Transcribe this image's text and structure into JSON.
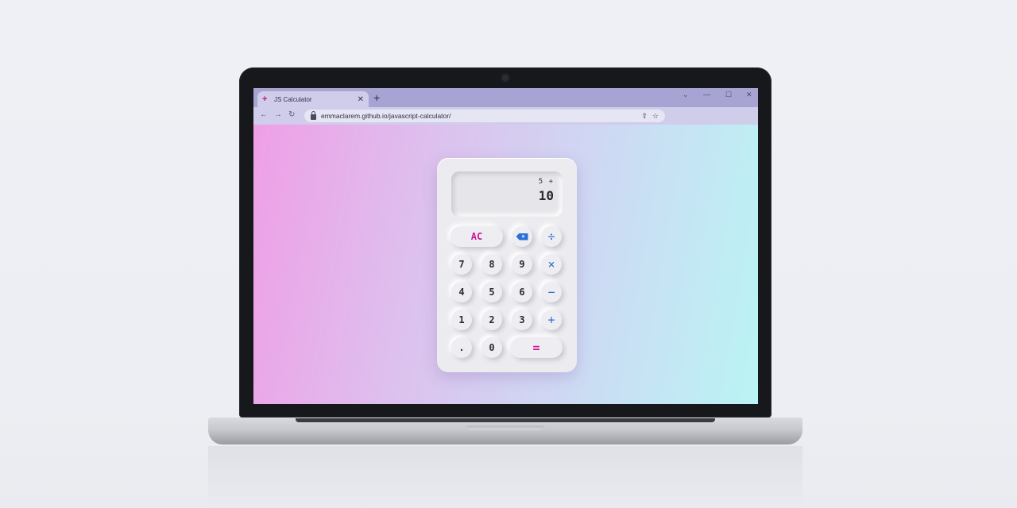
{
  "browser": {
    "tab_title": "JS Calculator",
    "tab_favicon": "+",
    "tab_close": "✕",
    "new_tab": "+",
    "url": "emmaclarem.github.io/javascript-calculator/",
    "icons": {
      "back": "←",
      "forward": "→",
      "reload": "↻",
      "share": "⇪",
      "bookmark": "☆",
      "menu_chevron": "⌄",
      "minimize": "—",
      "maximize": "☐",
      "close": "✕"
    }
  },
  "calculator": {
    "expression": "5 +",
    "result": "10",
    "keys": {
      "clear": "AC",
      "backspace": "×",
      "divide": "÷",
      "seven": "7",
      "eight": "8",
      "nine": "9",
      "multiply": "×",
      "four": "4",
      "five": "5",
      "six": "6",
      "subtract": "−",
      "one": "1",
      "two": "2",
      "three": "3",
      "add": "+",
      "decimal": ".",
      "zero": "0",
      "equals": "="
    },
    "colors": {
      "accent_pink": "#d0169a",
      "accent_blue": "#2a6fd6"
    }
  }
}
